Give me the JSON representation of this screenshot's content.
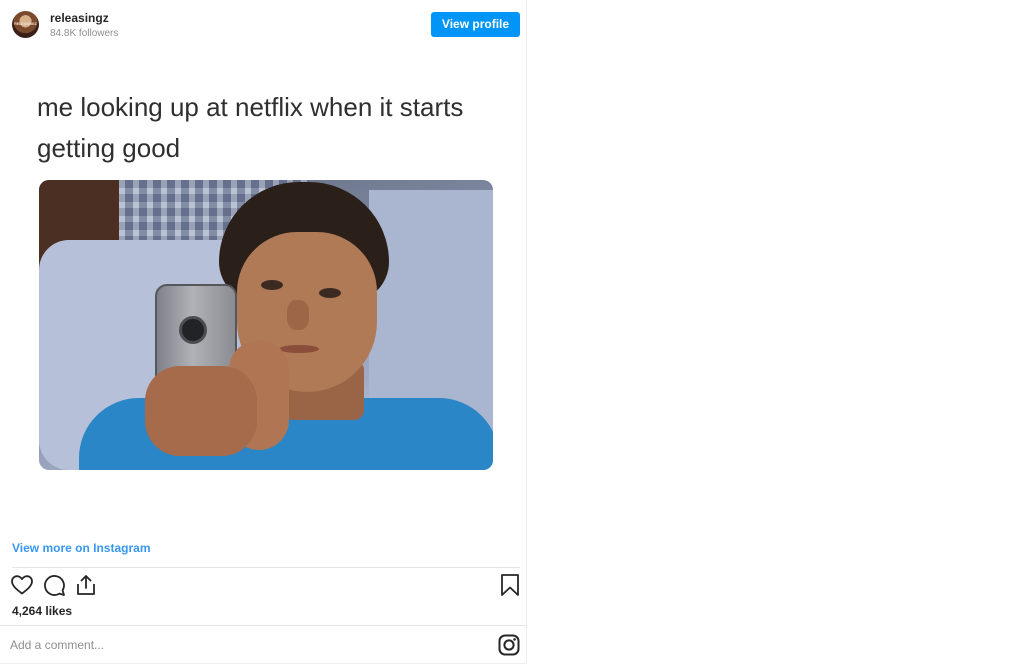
{
  "post": {
    "username": "releasingz",
    "followers": "84.8K followers",
    "avatar_text": "RELEASINGZ",
    "view_profile_label": "View profile",
    "caption": "me looking up at netflix when it starts getting good",
    "view_more_label": "View more on Instagram",
    "likes": "4,264 likes",
    "comment_placeholder": "Add a comment..."
  },
  "icons": {
    "like": "heart-icon",
    "comment": "comment-icon",
    "share": "share-icon",
    "save": "bookmark-icon",
    "brand": "instagram-icon"
  },
  "colors": {
    "accent": "#0095f6",
    "link": "#3897f0",
    "text": "#262626",
    "muted": "#8e8e8e",
    "divider": "#e6e6e6"
  }
}
